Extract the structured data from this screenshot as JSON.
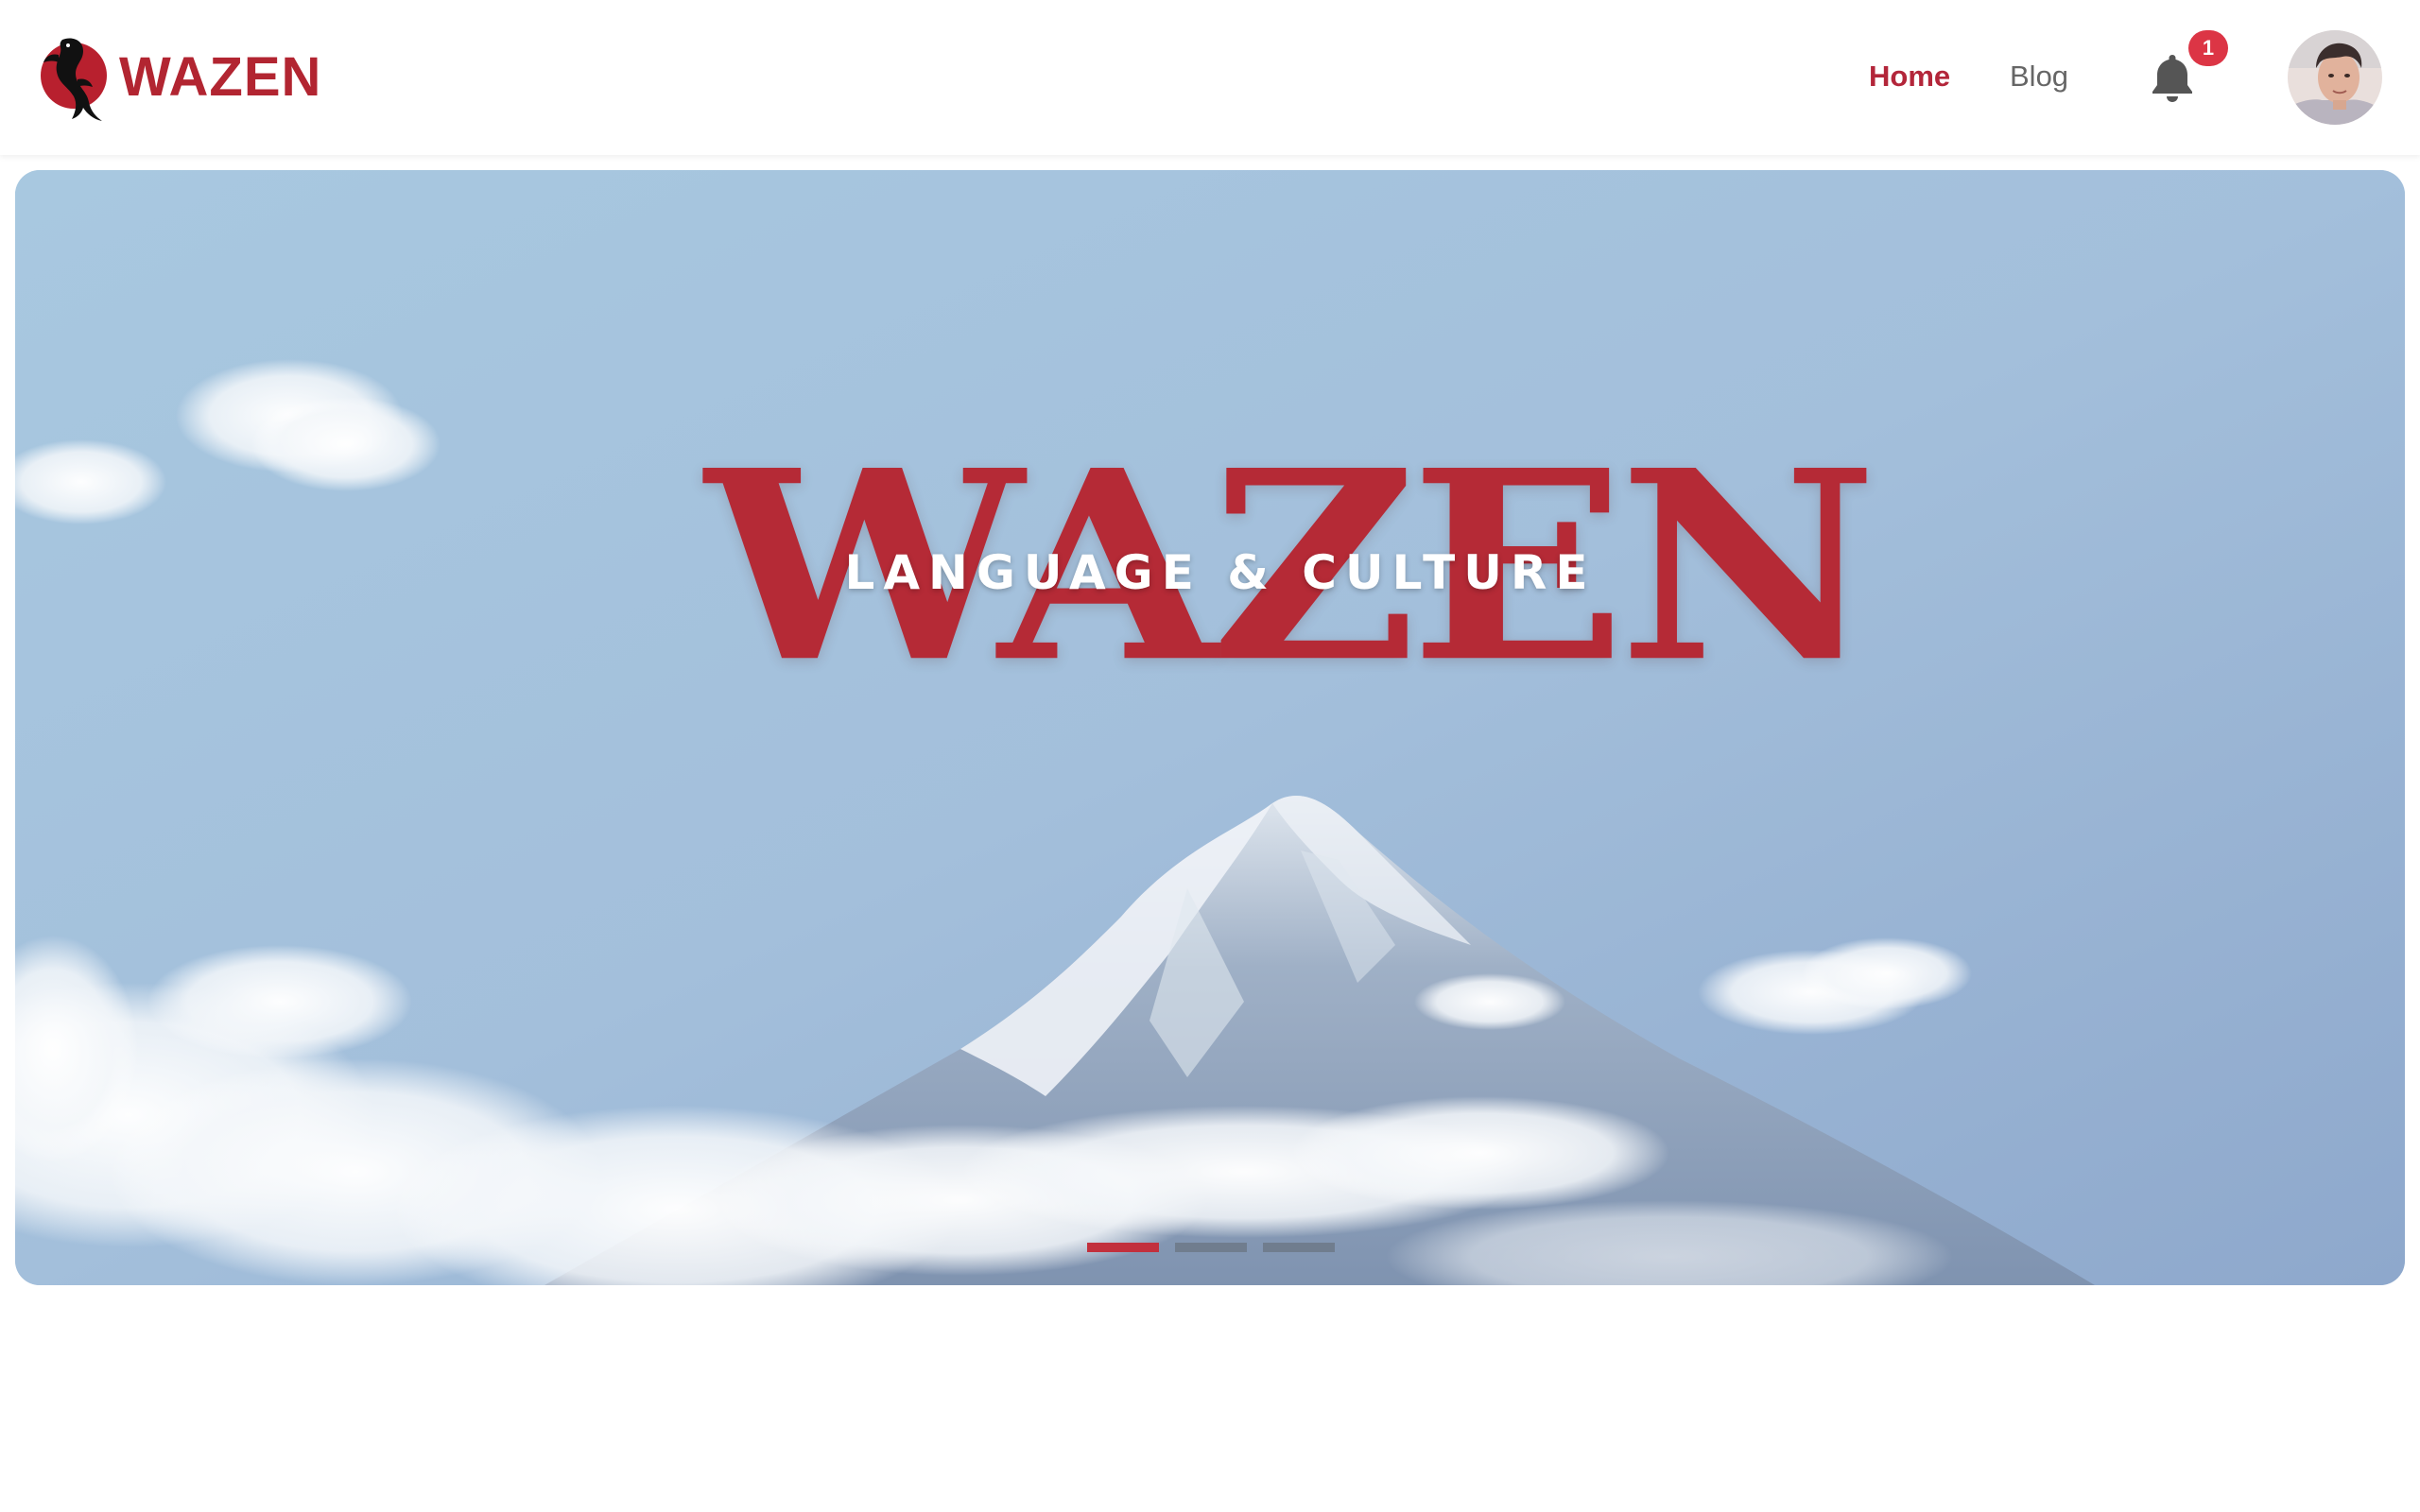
{
  "header": {
    "brand": {
      "name": "WAZEN",
      "logo_icon": "koi-fish-red-sun-icon"
    },
    "nav": [
      {
        "label": "Home",
        "active": true
      },
      {
        "label": "Blog",
        "active": false
      }
    ],
    "notifications": {
      "icon": "bell-icon",
      "count": "1"
    },
    "avatar": {
      "icon": "user-avatar-photo"
    }
  },
  "hero": {
    "title": "WAZEN",
    "subtitle": "LANGUAGE & CULTURE",
    "background": "mount-fuji-snow-clouds-photo",
    "slides_total": 3,
    "active_slide": 1
  },
  "colors": {
    "brand_red": "#b22531",
    "nav_active": "#b3263a",
    "nav_inactive": "#666666",
    "badge": "#dc3545",
    "indicator_active": "#c2303d",
    "indicator_inactive": "#6a7482"
  }
}
